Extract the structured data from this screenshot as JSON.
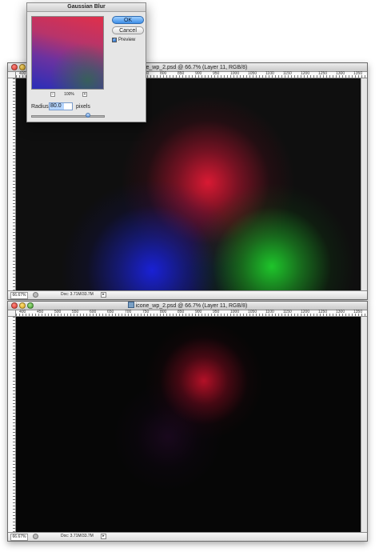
{
  "dialog": {
    "title": "Gaussian Blur",
    "ok_label": "OK",
    "cancel_label": "Cancel",
    "preview_label": "Preview",
    "preview_checked": true,
    "zoom_percent": "100%",
    "zoom_out_symbol": "−",
    "zoom_in_symbol": "+",
    "radius_label": "Radius:",
    "radius_value": "80.0",
    "radius_unit": "pixels"
  },
  "windows": [
    {
      "title": "icone_wp_2.psd @ 66.7% (Layer 11, RGB/8)",
      "zoom": "66.67%",
      "doc_info": "Doc: 3.71M/33.7M"
    },
    {
      "title": "icone_wp_2.psd @ 66.7% (Layer 11, RGB/8)",
      "zoom": "66.67%",
      "doc_info": "Doc: 3.71M/33.7M"
    }
  ],
  "ruler": {
    "top_labels": [
      "400",
      "450",
      "500",
      "550",
      "600",
      "650",
      "700",
      "750",
      "800",
      "850",
      "900",
      "950",
      "1000",
      "1050",
      "1100",
      "1150",
      "1200",
      "1250",
      "1300",
      "1350"
    ]
  },
  "colors": {
    "red_blob": "#e41a35",
    "green_blob": "#1fcf2c",
    "blue_blob": "#1a22e0",
    "accent": "#3e8ee6"
  },
  "status_arrow": "▸"
}
